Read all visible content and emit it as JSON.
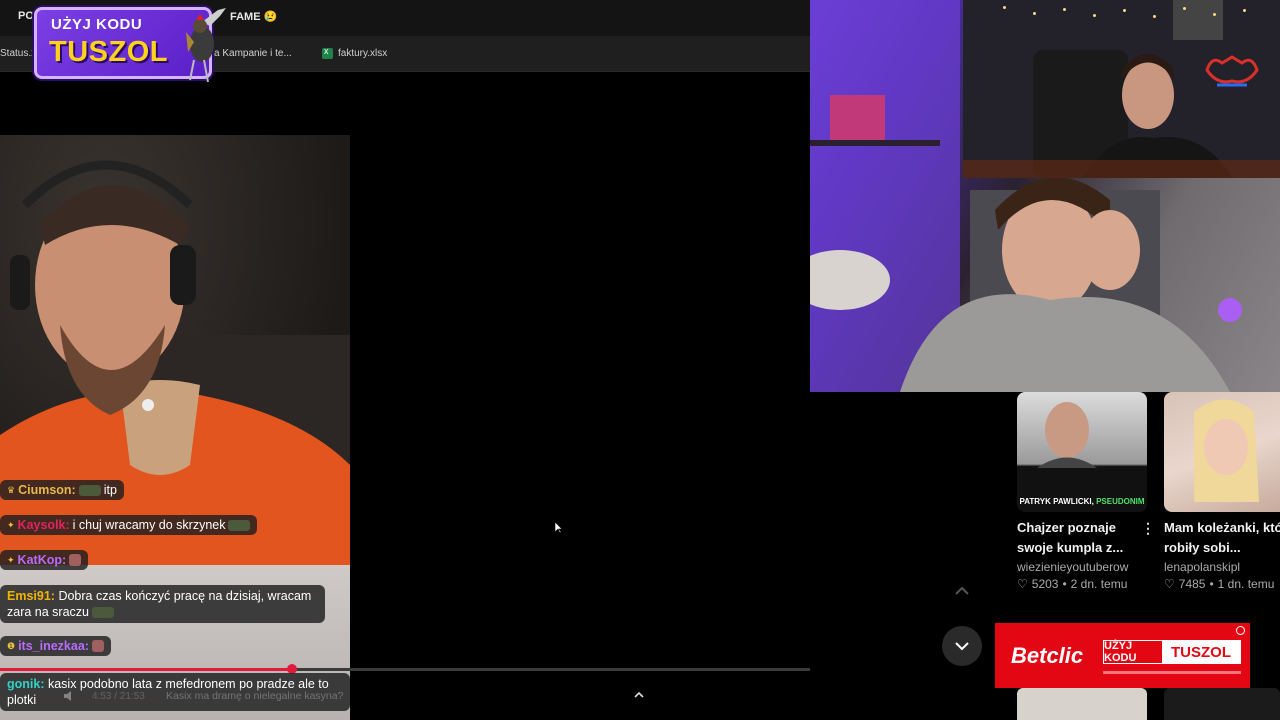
{
  "browser": {
    "tab_left": "POT",
    "tab_right": "FAME 😢",
    "bookmarks": [
      "Status.x",
      "a Kampanie i te...",
      "faktury.xlsx"
    ]
  },
  "promo": {
    "line1": "UŻYJ KODU",
    "line2": "TUSZOL"
  },
  "chat": [
    {
      "user": "Ciumson:",
      "user_color": "#e8b84b",
      "message": "itp"
    },
    {
      "user": "Kaysolk:",
      "user_color": "#e0245e",
      "message": "i chuj wracamy do skrzynek"
    },
    {
      "user": "KatKop:",
      "user_color": "#b86cff",
      "message": ""
    },
    {
      "user": "Emsi91:",
      "user_color": "#f0b400",
      "message": "Dobra czas kończyć pracę na dzisiaj, wracam zara na sraczu"
    },
    {
      "user": "its_inezkaa:",
      "user_color": "#b86cff",
      "message": ""
    },
    {
      "user": "gonik:",
      "user_color": "#2fd3c8",
      "message": "kasix podobno lata z mefedronem po pradze ale to plotki"
    }
  ],
  "player": {
    "progress_fraction": 0.36,
    "time": "4:53 / 21:53",
    "caption": "Kasix ma dramę o nielegalne kasyna?"
  },
  "recommendations": [
    {
      "title": "Chajzer poznaje swoje kumpla z...",
      "channel": "wiezienieyoutuberow",
      "views": "5203",
      "age": "2 dn. temu",
      "thumb_caption_prefix": "PATRYK PAWLICKI, ",
      "thumb_caption_highlight": "PSEUDONIM"
    },
    {
      "title": "Mam koleżanki, które robiły sobi...",
      "channel": "lenapolanskipl",
      "views": "7485",
      "age": "1 dn. temu"
    }
  ],
  "ad": {
    "brand": "Betclic",
    "code_label": "UŻYJ KODU",
    "code": "TUSZOL"
  },
  "colors": {
    "accent_red": "#e21b3c",
    "promo_purple": "#7b3fe4",
    "promo_yellow": "#ffd21e",
    "betclic_red": "#e30613"
  }
}
